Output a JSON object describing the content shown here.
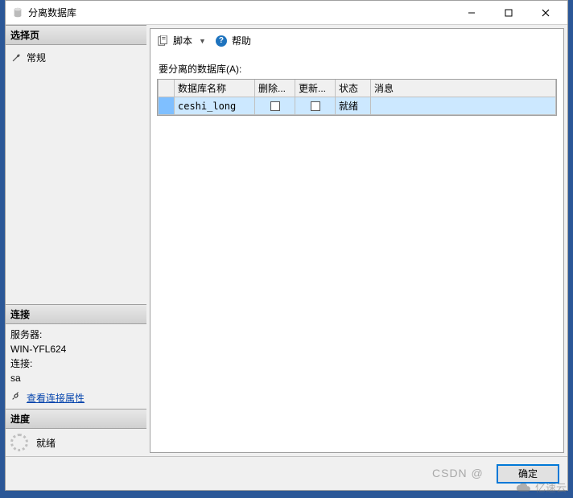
{
  "window": {
    "title": "分离数据库"
  },
  "left": {
    "select_page_header": "选择页",
    "general_label": "常规",
    "connection_header": "连接",
    "server_label": "服务器:",
    "server_value": "WIN-YFL624",
    "conn_label": "连接:",
    "conn_value": "sa",
    "view_conn_props": "查看连接属性",
    "progress_header": "进度",
    "progress_status": "就绪"
  },
  "toolbar": {
    "script_label": "脚本",
    "help_label": "帮助"
  },
  "main": {
    "table_label": "要分离的数据库(A):",
    "columns": {
      "name": "数据库名称",
      "delete": "删除...",
      "update": "更新...",
      "state": "状态",
      "message": "消息"
    },
    "rows": [
      {
        "name": "ceshi_long",
        "state": "就绪"
      }
    ]
  },
  "footer": {
    "ok_label": "确定"
  },
  "watermark": {
    "csdn": "CSDN @",
    "yisu": "亿速云"
  }
}
